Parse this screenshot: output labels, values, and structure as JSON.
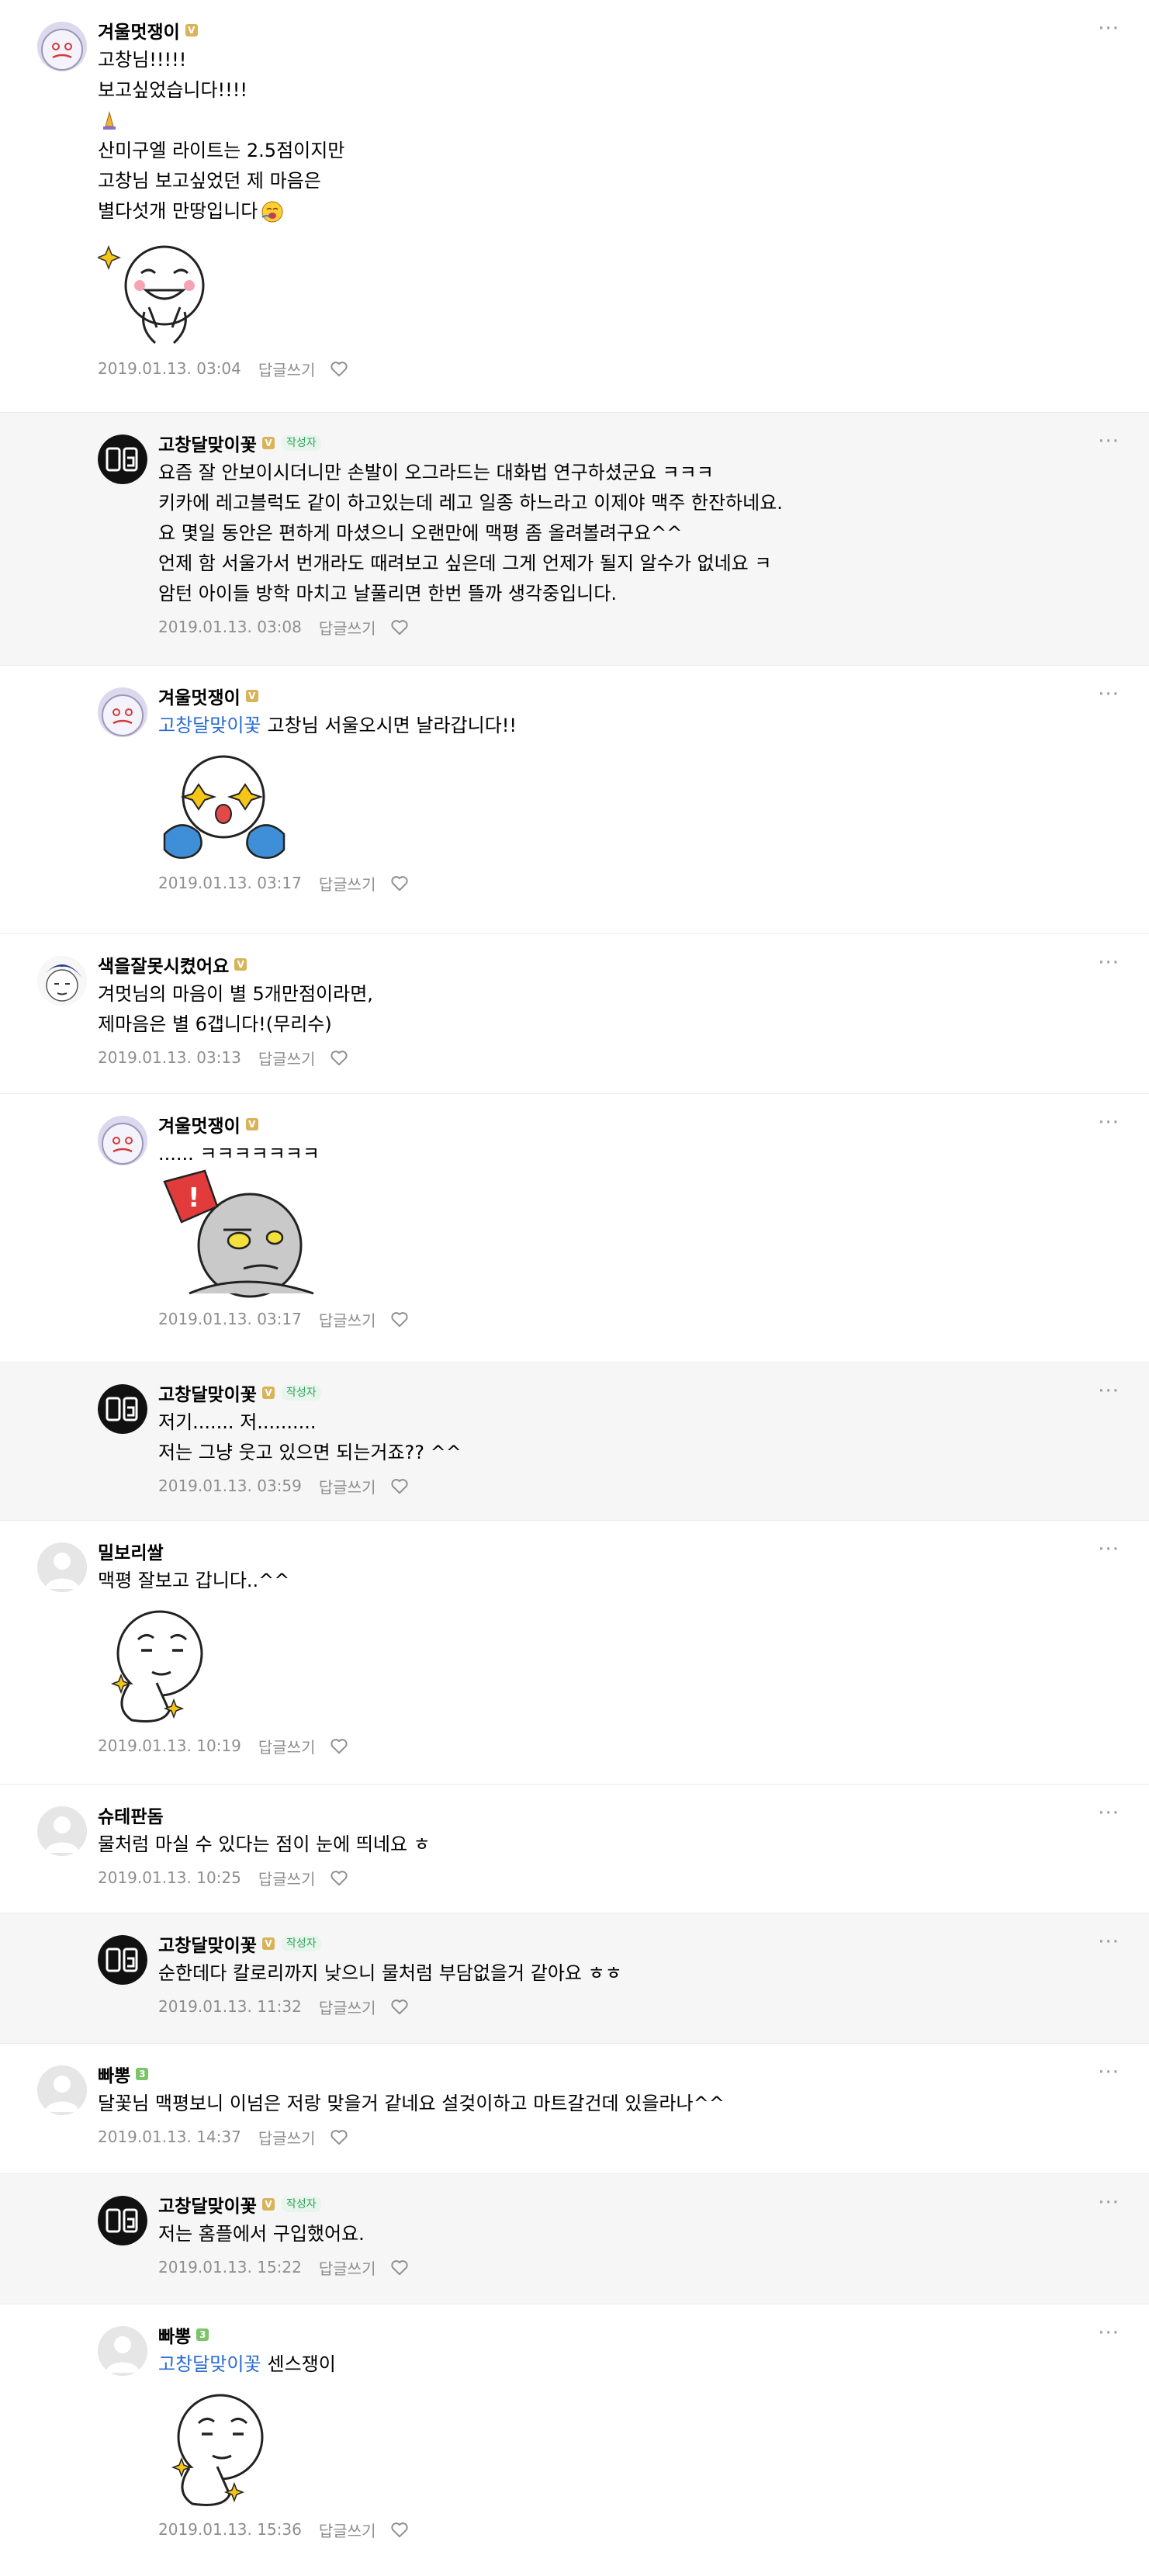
{
  "actions": {
    "reply": "답글쓰기",
    "more": "···"
  },
  "author_badge": "작성자",
  "comments": [
    {
      "nick": "겨울멋쟁이",
      "grade_label": "V",
      "lines": [
        "고창님!!!!!",
        "보고싶었습니다!!!!",
        "",
        "산미구엘 라이트는 2.5점이지만",
        "고창님 보고싶었던 제 마음은",
        "별다섯개 만땅입니다"
      ],
      "date": "2019.01.13. 03:04"
    },
    {
      "nick": "고창달맞이꽃",
      "grade_label": "V",
      "lines": [
        "요즘 잘 안보이시더니만 손발이 오그라드는 대화법 연구하셨군요 ㅋㅋㅋ",
        "키카에 레고블럭도 같이 하고있는데 레고 일종 하느라고 이제야 맥주 한잔하네요.",
        "요 몇일 동안은 편하게 마셨으니 오랜만에 맥평 좀 올려볼려구요^^",
        "언제 함 서울가서 번개라도 때려보고 싶은데 그게 언제가 될지 알수가 없네요 ㅋ",
        "암턴 아이들 방학 마치고 날풀리면 한번 뜰까 생각중입니다."
      ],
      "date": "2019.01.13. 03:08"
    },
    {
      "nick": "겨울멋쟁이",
      "grade_label": "V",
      "mention": "고창달맞이꽃",
      "lines": [
        "고창님 서울오시면 날라갑니다!!"
      ],
      "date": "2019.01.13. 03:17"
    },
    {
      "nick": "색을잘못시켰어요",
      "grade_label": "V",
      "lines": [
        "겨멋님의 마음이 별 5개만점이라면,",
        "제마음은 별 6갭니다!(무리수)"
      ],
      "date": "2019.01.13. 03:13"
    },
    {
      "nick": "겨울멋쟁이",
      "grade_label": "V",
      "lines": [
        "...... ㅋㅋㅋㅋㅋㅋㅋ"
      ],
      "date": "2019.01.13. 03:17"
    },
    {
      "nick": "고창달맞이꽃",
      "grade_label": "V",
      "lines": [
        "저기....... 저..........",
        "저는 그냥 웃고 있으면 되는거죠?? ^^"
      ],
      "date": "2019.01.13. 03:59"
    },
    {
      "nick": "밀보리쌀",
      "grade_label": "",
      "lines": [
        "맥평 잘보고 갑니다..^^"
      ],
      "date": "2019.01.13. 10:19"
    },
    {
      "nick": "슈테판돔",
      "grade_label": "",
      "lines": [
        "물처럼 마실 수 있다는 점이 눈에 띄네요 ㅎ"
      ],
      "date": "2019.01.13. 10:25"
    },
    {
      "nick": "고창달맞이꽃",
      "grade_label": "V",
      "lines": [
        "순한데다 칼로리까지 낮으니 물처럼 부담없을거 같아요 ㅎㅎ"
      ],
      "date": "2019.01.13. 11:32"
    },
    {
      "nick": "빠뽕",
      "grade_label": "3",
      "lines": [
        "달꽃님 맥평보니 이넘은 저랑 맞을거 같네요 설겆이하고 마트갈건데 있을라나^^"
      ],
      "date": "2019.01.13. 14:37"
    },
    {
      "nick": "고창달맞이꽃",
      "grade_label": "V",
      "lines": [
        "저는 홈플에서 구입했어요."
      ],
      "date": "2019.01.13. 15:22"
    },
    {
      "nick": "빠뽕",
      "grade_label": "3",
      "mention": "고창달맞이꽃",
      "lines": [
        "센스쟁이"
      ],
      "date": "2019.01.13. 15:36"
    }
  ],
  "colors": {
    "author_bg": "#f6f6f6",
    "mention": "#2a6bd1",
    "meta": "#8e8e8e",
    "badge_text": "#2fa55d"
  },
  "icons": [
    "heart-outline-icon",
    "more-icon",
    "author-avatar-icon",
    "moon-sticker",
    "default-avatar-icon"
  ]
}
